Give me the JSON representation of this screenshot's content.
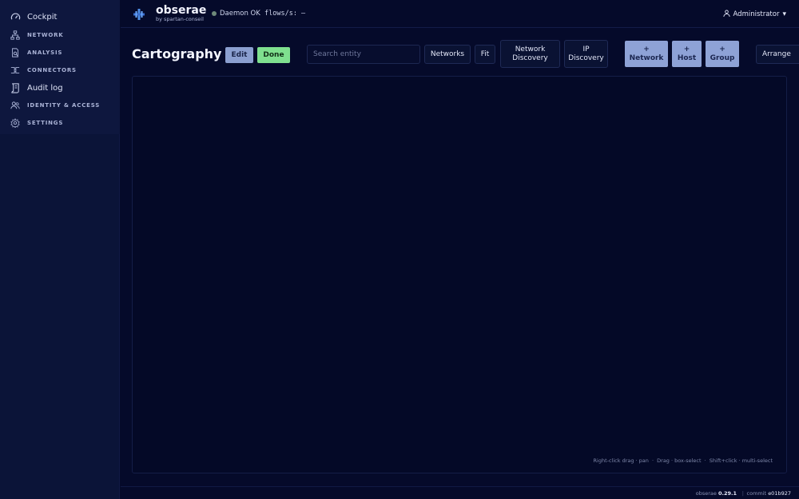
{
  "sidebar": {
    "items": [
      {
        "label": "Cockpit",
        "icon": "gauge-icon",
        "style": "big"
      },
      {
        "label": "NETWORK",
        "icon": "network-icon",
        "style": "caps"
      },
      {
        "label": "ANALYSIS",
        "icon": "analysis-icon",
        "style": "caps"
      },
      {
        "label": "CONNECTORS",
        "icon": "plug-icon",
        "style": "caps"
      },
      {
        "label": "Audit log",
        "icon": "scroll-icon",
        "style": "big"
      },
      {
        "label": "IDENTITY & ACCESS",
        "icon": "users-icon",
        "style": "caps"
      },
      {
        "label": "SETTINGS",
        "icon": "gear-icon",
        "style": "caps"
      }
    ]
  },
  "header": {
    "brand": "obserae",
    "brand_sub": "by spartan-conseil",
    "status": "Daemon OK",
    "flows": "flows/s: —",
    "user": "Administrator",
    "user_caret": "▾"
  },
  "toolbar": {
    "title": "Cartography",
    "edit": "Edit",
    "done": "Done",
    "search_placeholder": "Search entity",
    "networks": "Networks",
    "fit": "Fit",
    "network_discovery_1": "Network",
    "network_discovery_2": "Discovery",
    "ip_discovery_1": "IP",
    "ip_discovery_2": "Discovery",
    "add_network_1": "+",
    "add_network_2": "Network",
    "add_host_1": "+",
    "add_host_2": "Host",
    "add_group_1": "+",
    "add_group_2": "Group",
    "arrange": "Arrange"
  },
  "canvas": {
    "hint1": "Right-click drag · pan",
    "hint2": "Drag · box-select",
    "hint3": "Shift+click · multi-select"
  },
  "footer": {
    "app": "obserae",
    "version": "0.29.1",
    "separator": "|",
    "commit_label": "commit",
    "commit": "e01b927"
  },
  "colors": {
    "background": "#050a2a",
    "sidebar": "#0b1438",
    "accent_button": "#8ea2d6",
    "done_button": "#7fe08f",
    "status_dot": "#6f8a7a"
  }
}
